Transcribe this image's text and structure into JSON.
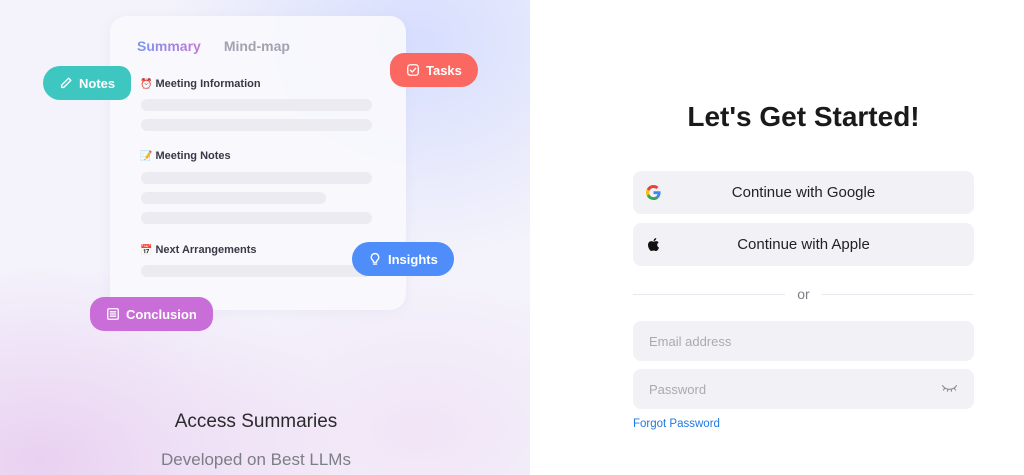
{
  "preview": {
    "tabs": {
      "summary": "Summary",
      "mindmap": "Mind-map"
    },
    "sections": [
      {
        "emoji": "⏰",
        "title": "Meeting Information"
      },
      {
        "emoji": "📝",
        "title": "Meeting Notes"
      },
      {
        "emoji": "📅",
        "title": "Next Arrangements"
      }
    ],
    "pills": {
      "notes": "Notes",
      "tasks": "Tasks",
      "insights": "Insights",
      "conclusion": "Conclusion"
    },
    "colors": {
      "notes": "#3ec7c0",
      "tasks": "#fb6761",
      "insights": "#4e8dfa",
      "conclusion": "#c96ed8"
    }
  },
  "promo": {
    "headline": "Access Summaries",
    "subline": "Developed on Best LLMs"
  },
  "auth": {
    "title": "Let's Get Started!",
    "google_label": "Continue with Google",
    "apple_label": "Continue with Apple",
    "divider_label": "or",
    "email_placeholder": "Email address",
    "password_placeholder": "Password",
    "forgot_label": "Forgot Password",
    "link_color": "#1f7ae0"
  }
}
